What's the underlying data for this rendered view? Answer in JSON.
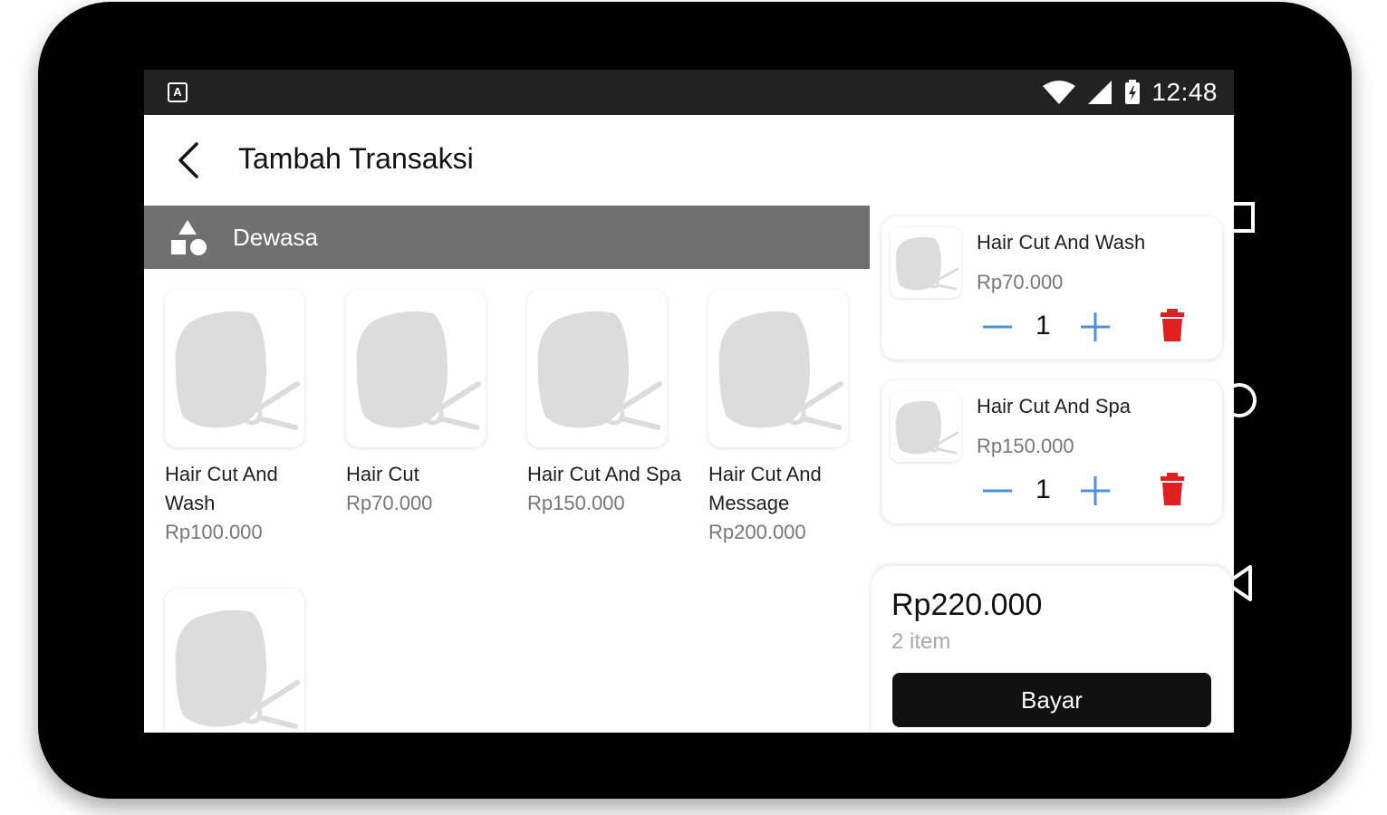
{
  "status_bar": {
    "notification_icon": "A",
    "time": "12:48"
  },
  "app_bar": {
    "title": "Tambah Transaksi"
  },
  "category": {
    "label": "Dewasa"
  },
  "products": [
    {
      "name": "Hair Cut And Wash",
      "price": "Rp100.000"
    },
    {
      "name": "Hair Cut",
      "price": "Rp70.000"
    },
    {
      "name": "Hair Cut And Spa",
      "price": "Rp150.000"
    },
    {
      "name": "Hair Cut And Message",
      "price": "Rp200.000"
    },
    {
      "name": "",
      "price": ""
    }
  ],
  "cart": {
    "items": [
      {
        "name": "Hair Cut And Wash",
        "price": "Rp70.000",
        "quantity": "1"
      },
      {
        "name": "Hair Cut And Spa",
        "price": "Rp150.000",
        "quantity": "1"
      }
    ]
  },
  "summary": {
    "total": "Rp220.000",
    "count": "2 item",
    "pay_label": "Bayar"
  },
  "colors": {
    "accent": "#4a90e2",
    "delete": "#e02020",
    "band": "#707070",
    "dark": "#111111"
  }
}
